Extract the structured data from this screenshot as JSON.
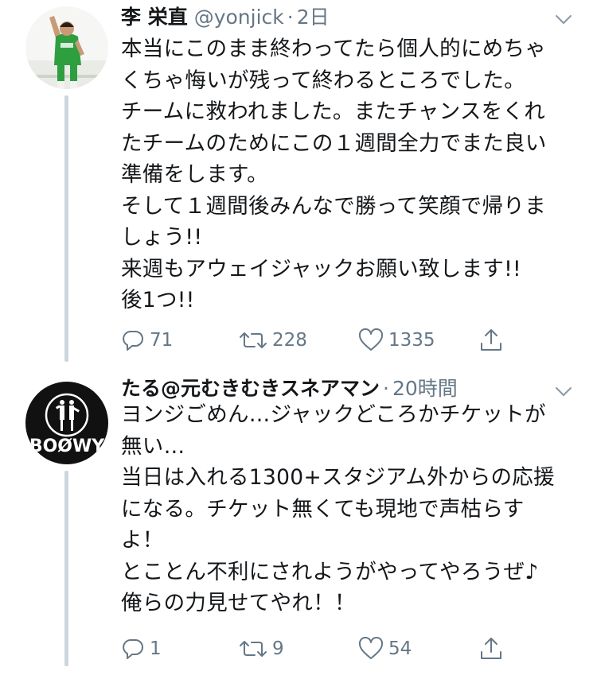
{
  "tweets": [
    {
      "name": "李 栄直",
      "handle": "@yonjick",
      "sep": "·",
      "time": "2日",
      "avatar_icon": "soccer-player-avatar",
      "lines": [
        "本当にこのまま終わってたら個人的にめちゃ",
        "くちゃ悔いが残って終わるところでした。",
        "チームに救われました。またチャンスをくれ",
        "たチームのためにこの１週間全力でまた良い",
        "準備をします。",
        "そして１週間後みんなで勝って笑顔で帰りま",
        "しょう!!",
        "来週もアウェイジャックお願い致します!!",
        "後1つ!!"
      ],
      "replies": "71",
      "retweets": "228",
      "likes": "1335"
    },
    {
      "name": "たる@元むきむきスネアマン",
      "handle": "",
      "sep": "·",
      "time": "20時間",
      "avatar_icon": "boowy-band-logo-avatar",
      "avatar_text": "BOØWY",
      "lines": [
        "ヨンジごめん…ジャックどころかチケットが",
        "無い…",
        "当日は入れる1300+スタジアム外からの応援",
        "になる。チケット無くても現地で声枯らす",
        "よ！",
        "とことん不利にされようがやってやろうぜ♪",
        "俺らの力見せてやれ！！"
      ],
      "replies": "1",
      "retweets": "9",
      "likes": "54"
    }
  ],
  "colors": {
    "text": "#14171a",
    "secondary": "#657786",
    "thread_line": "#ccd6dd",
    "jersey_green": "#2e9e3f"
  }
}
